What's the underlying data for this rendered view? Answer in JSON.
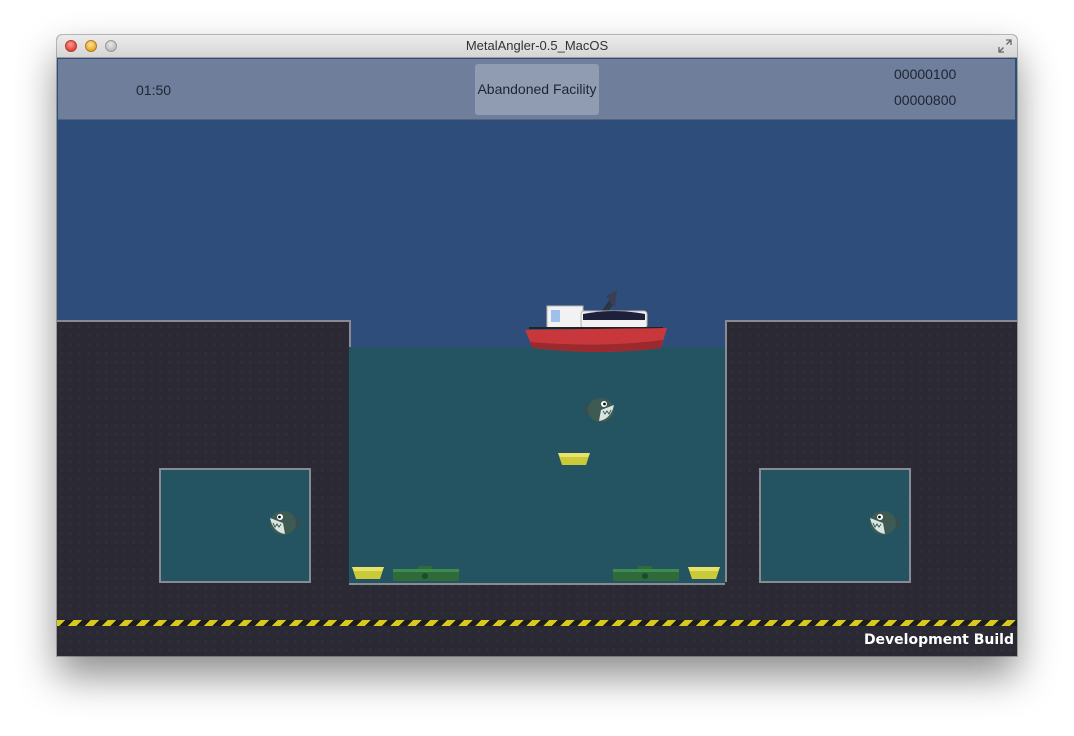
{
  "window": {
    "title": "MetalAngler-0.5_MacOS"
  },
  "hud": {
    "timer": "01:50",
    "level_name": "Abandoned Facility",
    "score": "00000100",
    "high_score": "00000800"
  },
  "footer": {
    "build_label": "Development Build"
  },
  "colors": {
    "sky": "#2f4d7a",
    "water": "#245461",
    "rock": "#2b2934",
    "hud_bar": "#6f7f9b",
    "hazard_yellow": "#d8c91e",
    "boat_hull": "#c8373c",
    "metal_pickup": "#c9c93a"
  },
  "entities": {
    "boat": "fishing-boat",
    "fish": [
      "piranha-fish",
      "piranha-fish",
      "piranha-fish"
    ],
    "pickups": [
      "metal-scrap",
      "metal-scrap",
      "metal-scrap"
    ],
    "debris": [
      "sunken-wreck",
      "sunken-wreck"
    ]
  }
}
